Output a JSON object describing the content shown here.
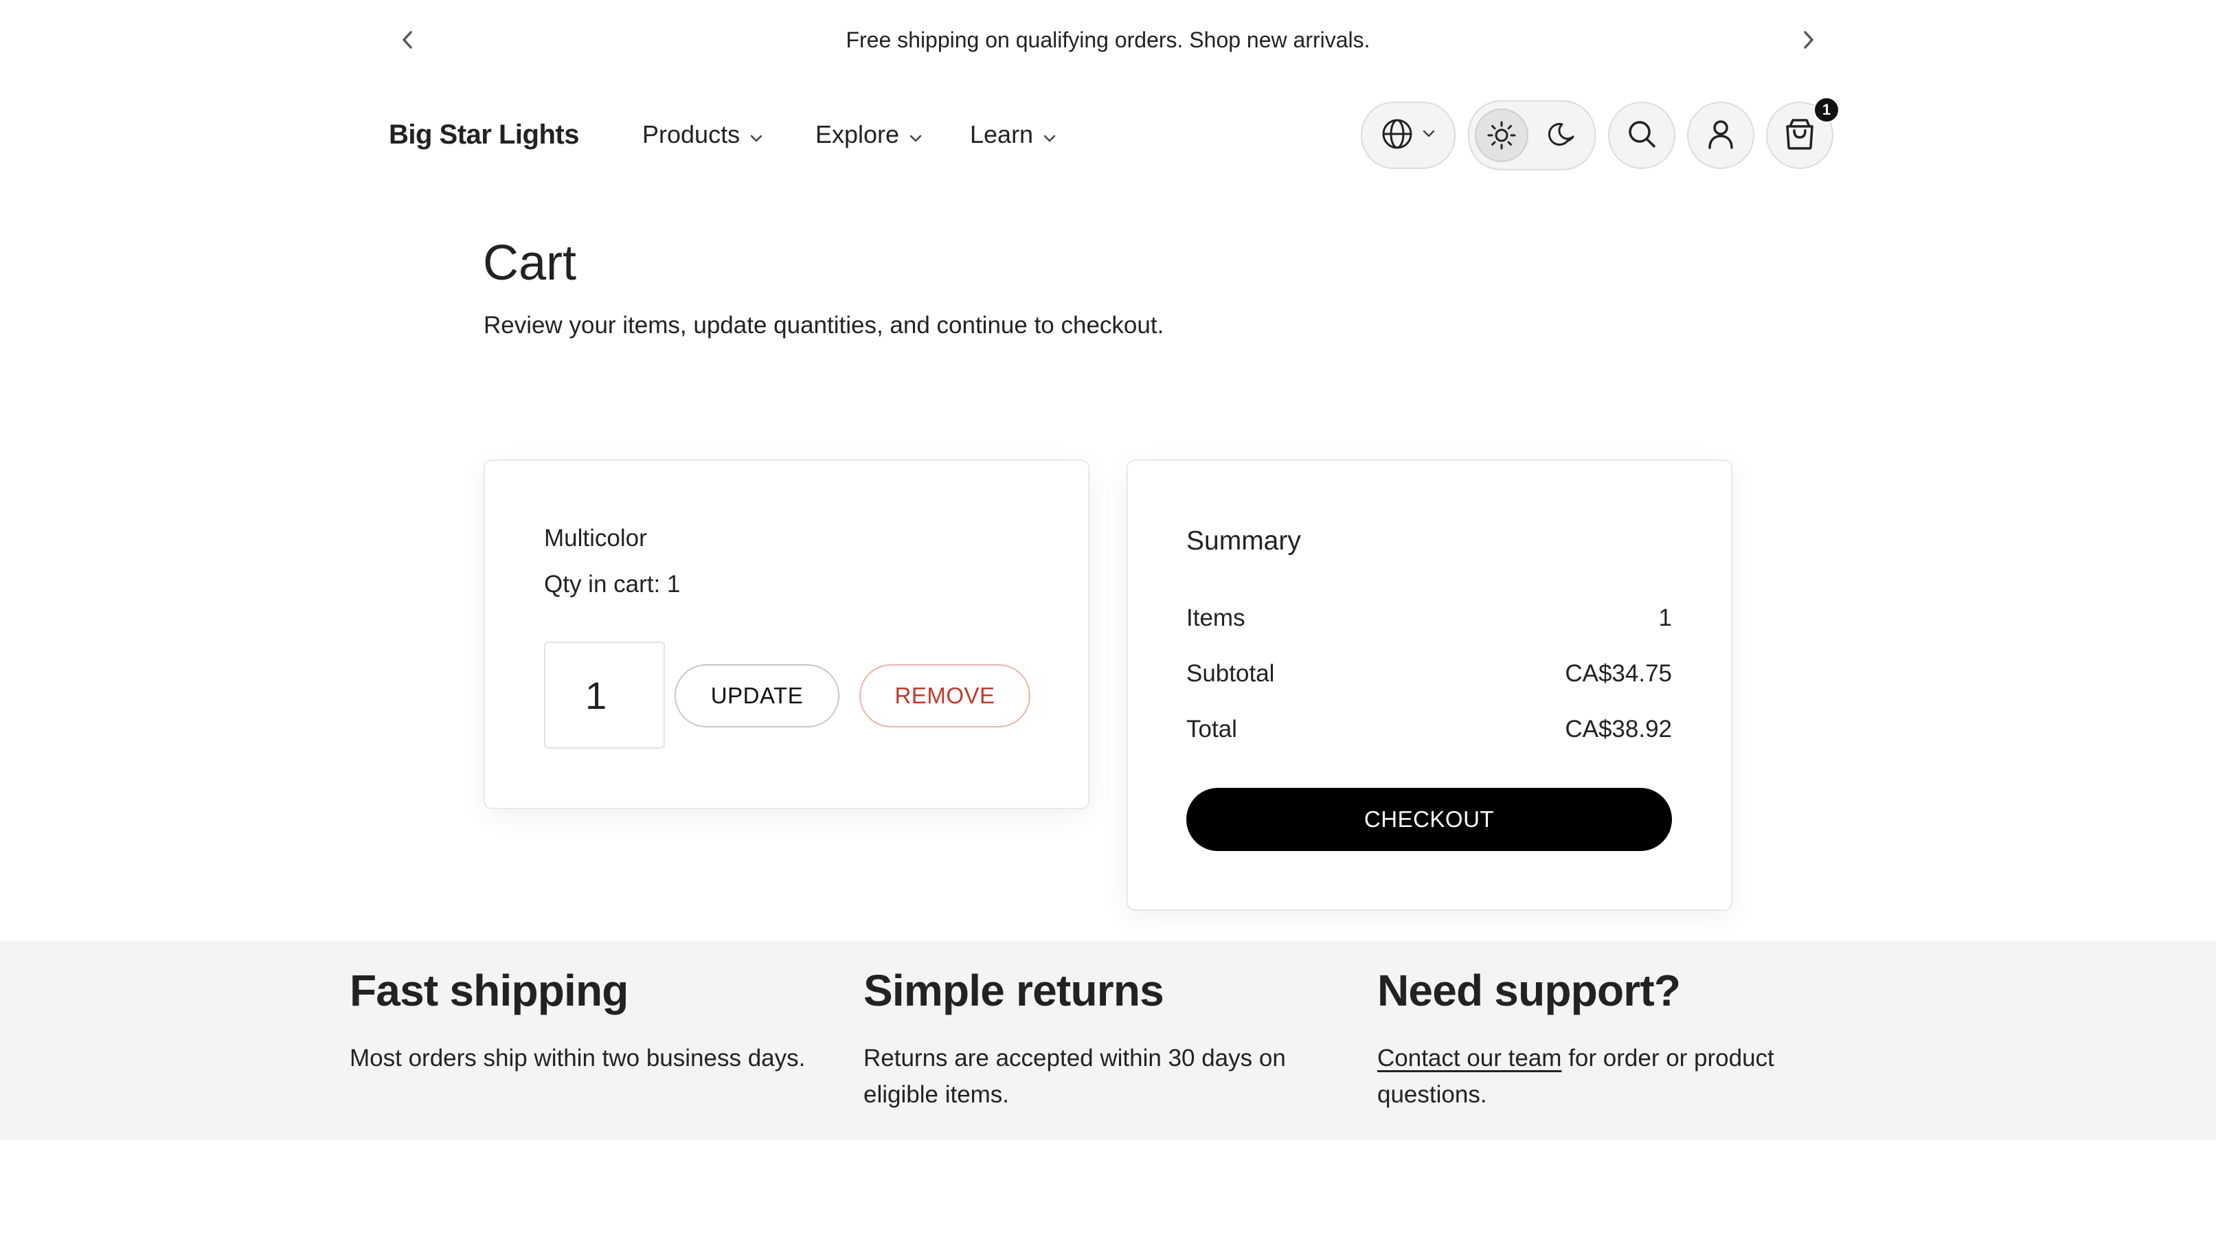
{
  "announcement": {
    "text": "Free shipping on qualifying orders. Shop new arrivals."
  },
  "header": {
    "logo": "Big Star Lights",
    "nav": [
      {
        "label": "Products"
      },
      {
        "label": "Explore"
      },
      {
        "label": "Learn"
      }
    ],
    "cart_count": "1"
  },
  "main": {
    "title": "Cart",
    "subtitle": "Review your items, update quantities, and continue to checkout."
  },
  "cart_item": {
    "name": "Multicolor",
    "qty_line": "Qty in cart: 1",
    "qty_value": "1",
    "update_label": "UPDATE",
    "remove_label": "REMOVE"
  },
  "summary": {
    "heading": "Summary",
    "rows": [
      {
        "label": "Items",
        "value": "1"
      },
      {
        "label": "Subtotal",
        "value": "CA$34.75"
      },
      {
        "label": "Total",
        "value": "CA$38.92"
      }
    ],
    "checkout_label": "CHECKOUT"
  },
  "features": [
    {
      "title": "Fast shipping",
      "text": "Most orders ship within two business days."
    },
    {
      "title": "Simple returns",
      "text": "Returns are accepted within 30 days on eligible items."
    },
    {
      "title": "Need support?",
      "link": "Contact our team",
      "text": " for order or product questions."
    }
  ],
  "colors": {
    "accent": "#000000",
    "remove": "#c0392b",
    "band": "#f4f4f4"
  }
}
